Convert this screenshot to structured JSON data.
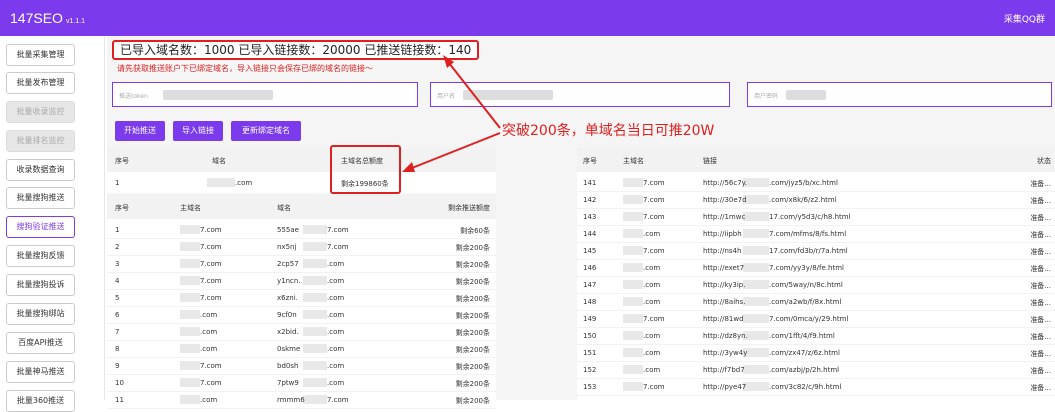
{
  "app": {
    "name": "147SEO",
    "version": "v1.1.1",
    "qq_label": "采集QQ群"
  },
  "sidebar": {
    "items": [
      {
        "label": "批量采集管理",
        "state": "normal"
      },
      {
        "label": "批量发布管理",
        "state": "normal"
      },
      {
        "label": "批量收录监控",
        "state": "disabled"
      },
      {
        "label": "批量排名监控",
        "state": "disabled"
      },
      {
        "label": "收录数据查询",
        "state": "normal"
      },
      {
        "label": "批量搜狗推送",
        "state": "normal"
      },
      {
        "label": "搜狗验证推送",
        "state": "active"
      },
      {
        "label": "批量搜狗反馈",
        "state": "normal"
      },
      {
        "label": "批量搜狗投诉",
        "state": "normal"
      },
      {
        "label": "批量搜狗绑站",
        "state": "normal"
      },
      {
        "label": "百度API推送",
        "state": "normal"
      },
      {
        "label": "批量神马推送",
        "state": "normal"
      },
      {
        "label": "批量360推送",
        "state": "normal"
      }
    ]
  },
  "stats": {
    "text": "已导入域名数：1000 已导入链接数：20000 已推送链接数：140"
  },
  "hint": "请先获取推送账户下已绑定域名，导入链接只会保存已绑的域名的链接～",
  "fields": {
    "token": "推送token",
    "username": "用户名",
    "password": "用户密码"
  },
  "buttons": {
    "start": "开始推送",
    "import": "导入链接",
    "rebind": "更新绑定域名"
  },
  "callout": "突破200条，单域名当日可推20W",
  "summary_table": {
    "headers": {
      "no": "序号",
      "domain": "域名",
      "quota": "主域名总额度"
    },
    "row": {
      "no": "1",
      "domain": ".com",
      "quota": "剩余199860条"
    }
  },
  "domain_table": {
    "headers": {
      "no": "序号",
      "main": "主域名",
      "domain": "域名",
      "quota": "剩余推送额度"
    },
    "rows": [
      {
        "no": "1",
        "main": "7.com",
        "domain": "555ae",
        "domain_tail": "7.com",
        "quota": "剩余60条"
      },
      {
        "no": "2",
        "main": "7.com",
        "domain": "nx5nj",
        "domain_tail": "7.com",
        "quota": "剩余200条"
      },
      {
        "no": "3",
        "main": "7.com",
        "domain": "2cp57",
        "domain_tail": ".com",
        "quota": "剩余200条"
      },
      {
        "no": "4",
        "main": "7.com",
        "domain": "y1ncn.",
        "domain_tail": ".com",
        "quota": "剩余200条"
      },
      {
        "no": "5",
        "main": "7.com",
        "domain": "x6zni.",
        "domain_tail": ".com",
        "quota": "剩余200条"
      },
      {
        "no": "6",
        "main": ".com",
        "domain": "9cf0n",
        "domain_tail": ".com",
        "quota": "剩余200条"
      },
      {
        "no": "7",
        "main": ".com",
        "domain": "x2bid.",
        "domain_tail": ".com",
        "quota": "剩余200条"
      },
      {
        "no": "8",
        "main": ".com",
        "domain": "0skme",
        "domain_tail": ".com",
        "quota": "剩余200条"
      },
      {
        "no": "9",
        "main": "7.com",
        "domain": "bd0sh",
        "domain_tail": ".com",
        "quota": "剩余200条"
      },
      {
        "no": "10",
        "main": "7.com",
        "domain": "7ptw9",
        "domain_tail": ".com",
        "quota": "剩余200条"
      },
      {
        "no": "11",
        "main": ".com",
        "domain": "rmmm6",
        "domain_tail": "7.com",
        "quota": "剩余200条"
      }
    ]
  },
  "push_table": {
    "headers": {
      "no": "序号",
      "main": "主域名",
      "link": "链接",
      "status": "状态"
    },
    "rows": [
      {
        "no": "141",
        "main": "7.com",
        "link": "http://56c7y.",
        "link_tail": ".com/jyz5/b/xc.html",
        "status": "准备..."
      },
      {
        "no": "142",
        "main": "7.com",
        "link": "http://30e7d",
        "link_tail": ".com/x8k/6/z2.html",
        "status": "准备..."
      },
      {
        "no": "143",
        "main": "7.com",
        "link": "http://1mwc",
        "link_tail": "17.com/y5d3/c/h8.html",
        "status": "准备..."
      },
      {
        "no": "144",
        "main": ".com",
        "link": "http://iipbh",
        "link_tail": "7.com/mfms/8/fs.html",
        "status": "准备..."
      },
      {
        "no": "145",
        "main": "7.com",
        "link": "http://ns4h",
        "link_tail": "17.com/fd3b/r/7a.html",
        "status": "准备..."
      },
      {
        "no": "146",
        "main": ".com",
        "link": "http://exet7",
        "link_tail": "7.com/yy3y/8/fe.html",
        "status": "准备..."
      },
      {
        "no": "147",
        "main": ".com",
        "link": "http://ky3ip.",
        "link_tail": ".com/5way/n/8c.html",
        "status": "准备..."
      },
      {
        "no": "148",
        "main": ".com",
        "link": "http://8aihs.",
        "link_tail": ".com/a2wb/f/8x.html",
        "status": "准备..."
      },
      {
        "no": "149",
        "main": "7.com",
        "link": "http://81wd",
        "link_tail": "7.com/0mca/y/29.html",
        "status": "准备..."
      },
      {
        "no": "150",
        "main": ".com",
        "link": "http://dz8yn.",
        "link_tail": ".com/1fft/4/f9.html",
        "status": "准备..."
      },
      {
        "no": "151",
        "main": ".com",
        "link": "http://3yw4y",
        "link_tail": ".com/zx47/z/6z.html",
        "status": "准备..."
      },
      {
        "no": "152",
        "main": ".com",
        "link": "http://f7bd7",
        "link_tail": ".com/azbj/p/2h.html",
        "status": "准备..."
      },
      {
        "no": "153",
        "main": "7.com",
        "link": "http://pye47",
        "link_tail": ".com/3c82/c/9h.html",
        "status": "准备..."
      }
    ]
  },
  "colors": {
    "accent": "#7c3aed",
    "annotation": "#e02020"
  }
}
